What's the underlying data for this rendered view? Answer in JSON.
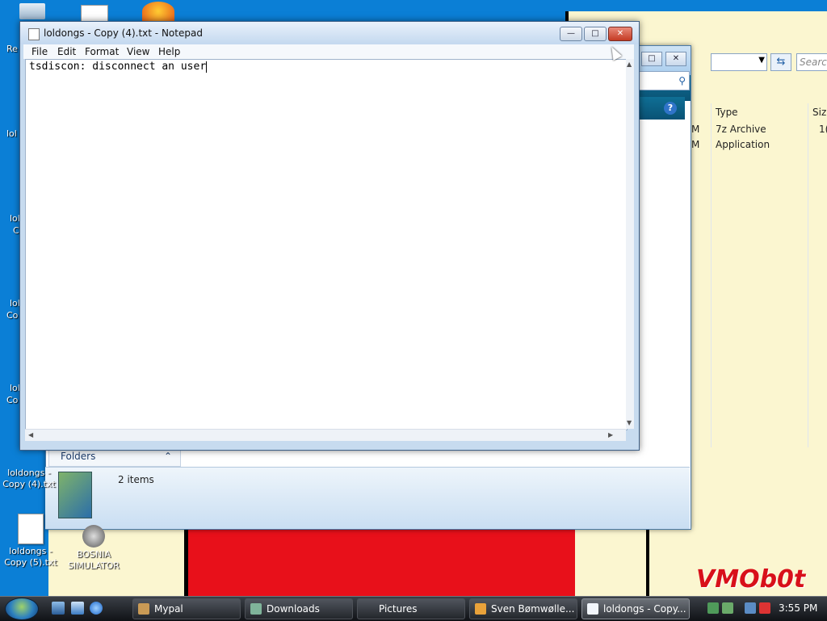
{
  "desktop": {
    "icons": [
      {
        "label": "loldongs - Copy (4).txt"
      },
      {
        "label": "loldongs - Copy (5).txt"
      },
      {
        "label": "BOSNIA SIMULATOR"
      }
    ],
    "cut_labels": [
      "Re",
      "lol",
      "lol",
      "C",
      "lol",
      "Co",
      "lol",
      "Co"
    ],
    "watermark": "VMOb0t"
  },
  "explorer": {
    "search_placeholder": "Search",
    "columns": [
      "Type",
      "Size"
    ],
    "rows": [
      {
        "date_tail": "M",
        "type": "7z Archive",
        "size_head": "1("
      },
      {
        "date_tail": "M",
        "type": "Application",
        "size_head": ""
      }
    ],
    "folders_label": "Folders",
    "item_count": "2 items",
    "help_glyph": "?"
  },
  "notepad": {
    "title": "loldongs - Copy (4).txt - Notepad",
    "menu": [
      "File",
      "Edit",
      "Format",
      "View",
      "Help"
    ],
    "content": "tsdiscon: disconnect an user"
  },
  "taskbar": {
    "buttons": [
      {
        "label": "Mypal",
        "icon": "mypal-icon"
      },
      {
        "label": "Downloads",
        "icon": "folder-icon"
      },
      {
        "label": "Pictures",
        "icon": ""
      },
      {
        "label": "Sven Bømwølle...",
        "icon": "fox-icon"
      },
      {
        "label": "loldongs - Copy...",
        "icon": "notepad-icon"
      }
    ],
    "clock": "3:55 PM"
  }
}
